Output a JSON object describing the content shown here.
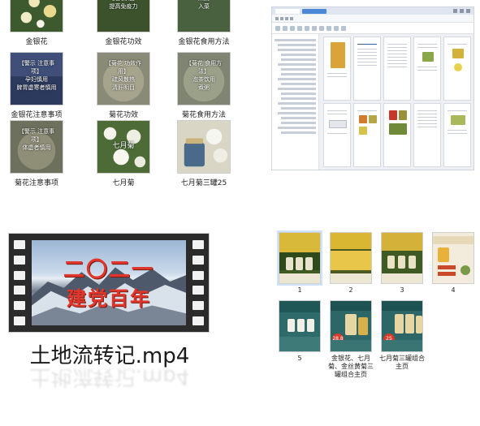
{
  "file_grid": {
    "items": [
      {
        "label": "金银花",
        "thumb_text": ""
      },
      {
        "label": "金银花功效",
        "thumb_text": "清热解毒\n抗炎杀菌\n提高免疫力"
      },
      {
        "label": "金银花食用方法",
        "thumb_text": "泡茶\n煮粥\n入菜"
      },
      {
        "label": "金银花注意事项",
        "thumb_text": "【警示 注意事项】\n孕妇慎用\n脾胃虚寒者慎用"
      },
      {
        "label": "菊花功效",
        "thumb_text": "【菊花 功效作用】\n疏风散热\n清肝明目"
      },
      {
        "label": "菊花食用方法",
        "thumb_text": "【菊花 食用方法】\n泡茶饮用\n煮粥"
      },
      {
        "label": "菊花注意事项",
        "thumb_text": "【警示 注意事项】\n体虚者慎用"
      },
      {
        "label": "七月菊",
        "thumb_text": "七月菊"
      },
      {
        "label": "七月菊三罐25",
        "thumb_text": ""
      }
    ]
  },
  "doc_viewer": {
    "window_title": "菊花金银花产品介绍",
    "tabs": [
      "首页",
      "菊花金银花产品介绍"
    ],
    "zoom": ""
  },
  "video_file": {
    "name": "土地流转记.mp4",
    "frame_line1": "二〇二一",
    "frame_line2": "建党百年"
  },
  "image_grid": {
    "items": [
      {
        "label": "1"
      },
      {
        "label": "2"
      },
      {
        "label": "3"
      },
      {
        "label": "4"
      },
      {
        "label": "5"
      },
      {
        "label": "金银花、七月菊、金丝黄菊三罐组合主页",
        "badge": "28.8"
      },
      {
        "label": "七月菊三罐组合主页",
        "badge": "25"
      }
    ]
  },
  "colors": {
    "accent": "#4a88d6",
    "video_title_red": "#e0362b",
    "selection": "#cfe3ff"
  }
}
